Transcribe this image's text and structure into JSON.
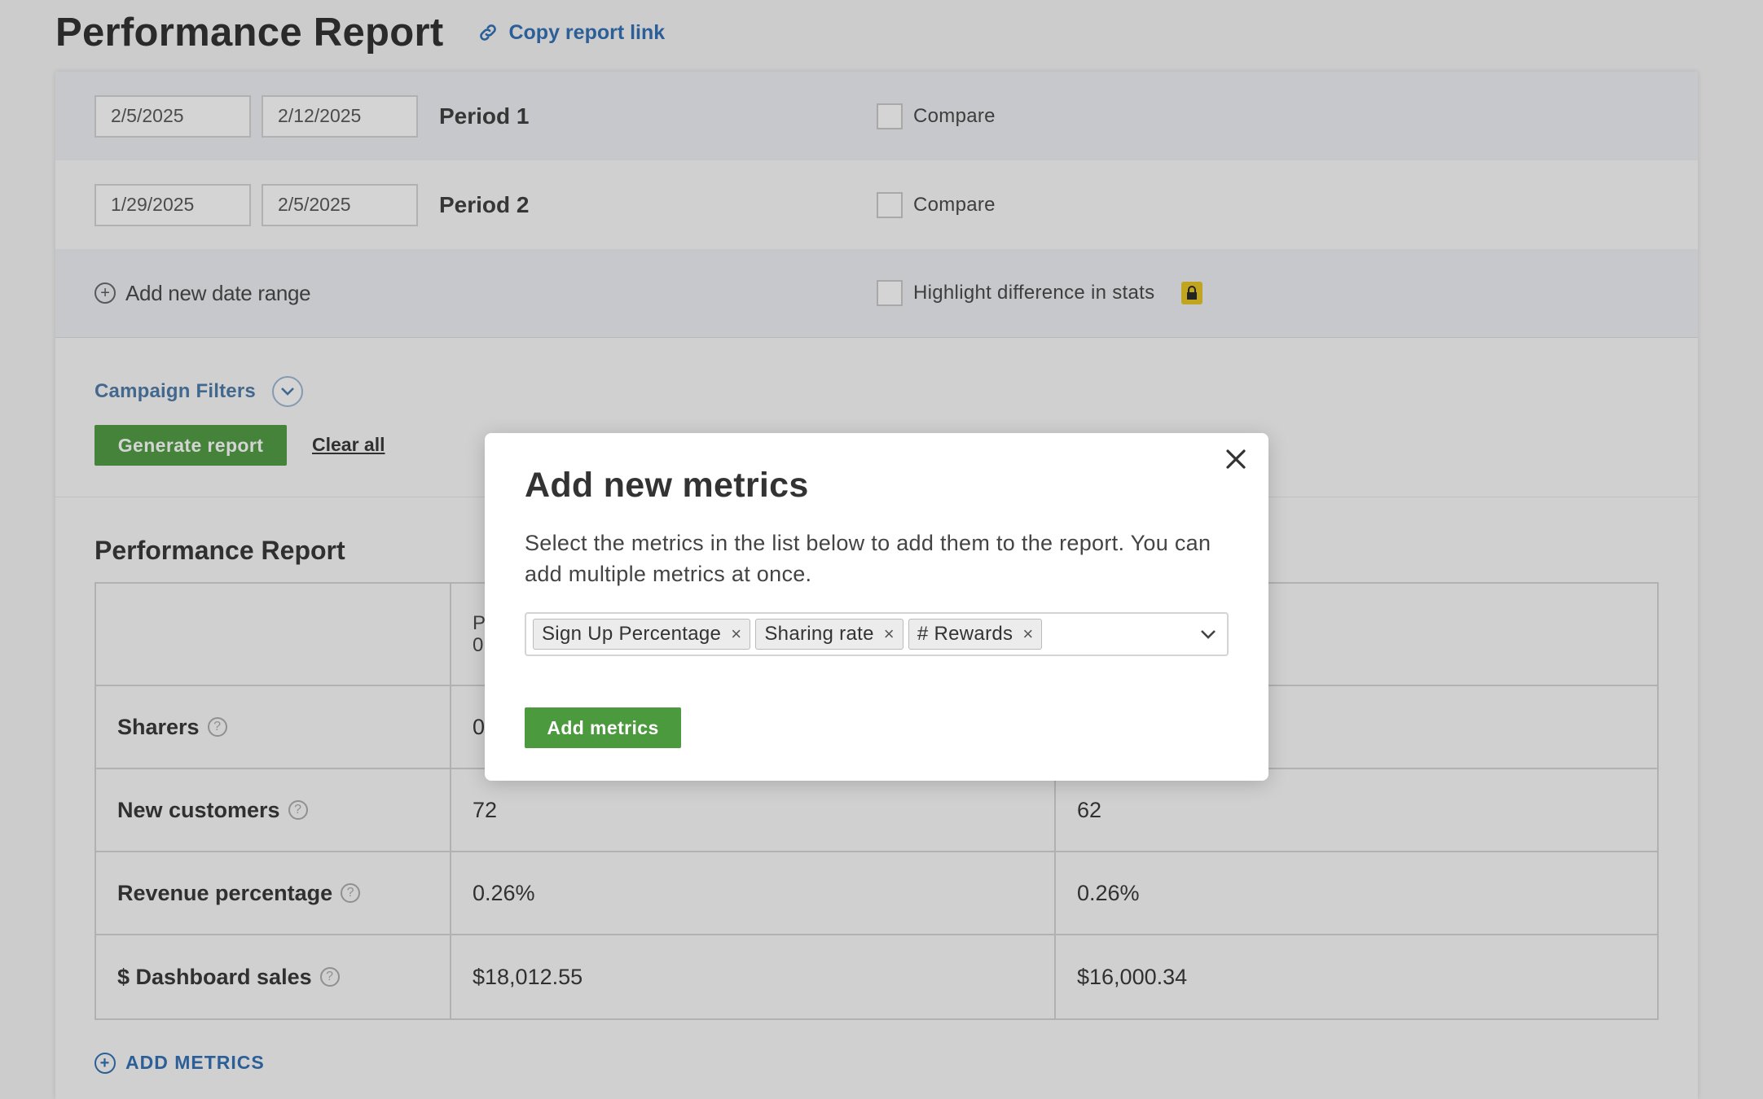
{
  "header": {
    "title": "Performance Report",
    "copy_link_label": "Copy report link"
  },
  "date_ranges": [
    {
      "start": "2/5/2025",
      "end": "2/12/2025",
      "label": "Period 1",
      "compare_label": "Compare",
      "compare_checked": false
    },
    {
      "start": "1/29/2025",
      "end": "2/5/2025",
      "label": "Period 2",
      "compare_label": "Compare",
      "compare_checked": false
    }
  ],
  "add_range_label": "Add new date range",
  "highlight_label": "Highlight difference in stats",
  "filters": {
    "label": "Campaign Filters",
    "generate_label": "Generate report",
    "clear_label": "Clear all"
  },
  "report": {
    "title": "Performance Report",
    "header_cells": [
      "",
      "P\n0",
      ""
    ],
    "rows": [
      {
        "metric": "Sharers",
        "p1": "0",
        "p2": ""
      },
      {
        "metric": "New customers",
        "p1": "72",
        "p2": "62"
      },
      {
        "metric": "Revenue percentage",
        "p1": "0.26%",
        "p2": "0.26%"
      },
      {
        "metric": "$ Dashboard sales",
        "p1": "$18,012.55",
        "p2": "$16,000.34"
      }
    ],
    "add_metrics_label": "ADD METRICS"
  },
  "modal": {
    "title": "Add new metrics",
    "description": "Select the metrics in the list below to add them to the report. You can add multiple metrics at once.",
    "selected_tags": [
      "Sign Up Percentage",
      "Sharing rate",
      "# Rewards"
    ],
    "tag_remove_glyph": "×",
    "submit_label": "Add metrics"
  },
  "colors": {
    "accent_blue": "#2d6db5",
    "button_green": "#4c9a3e",
    "lock_yellow": "#e8c520"
  }
}
